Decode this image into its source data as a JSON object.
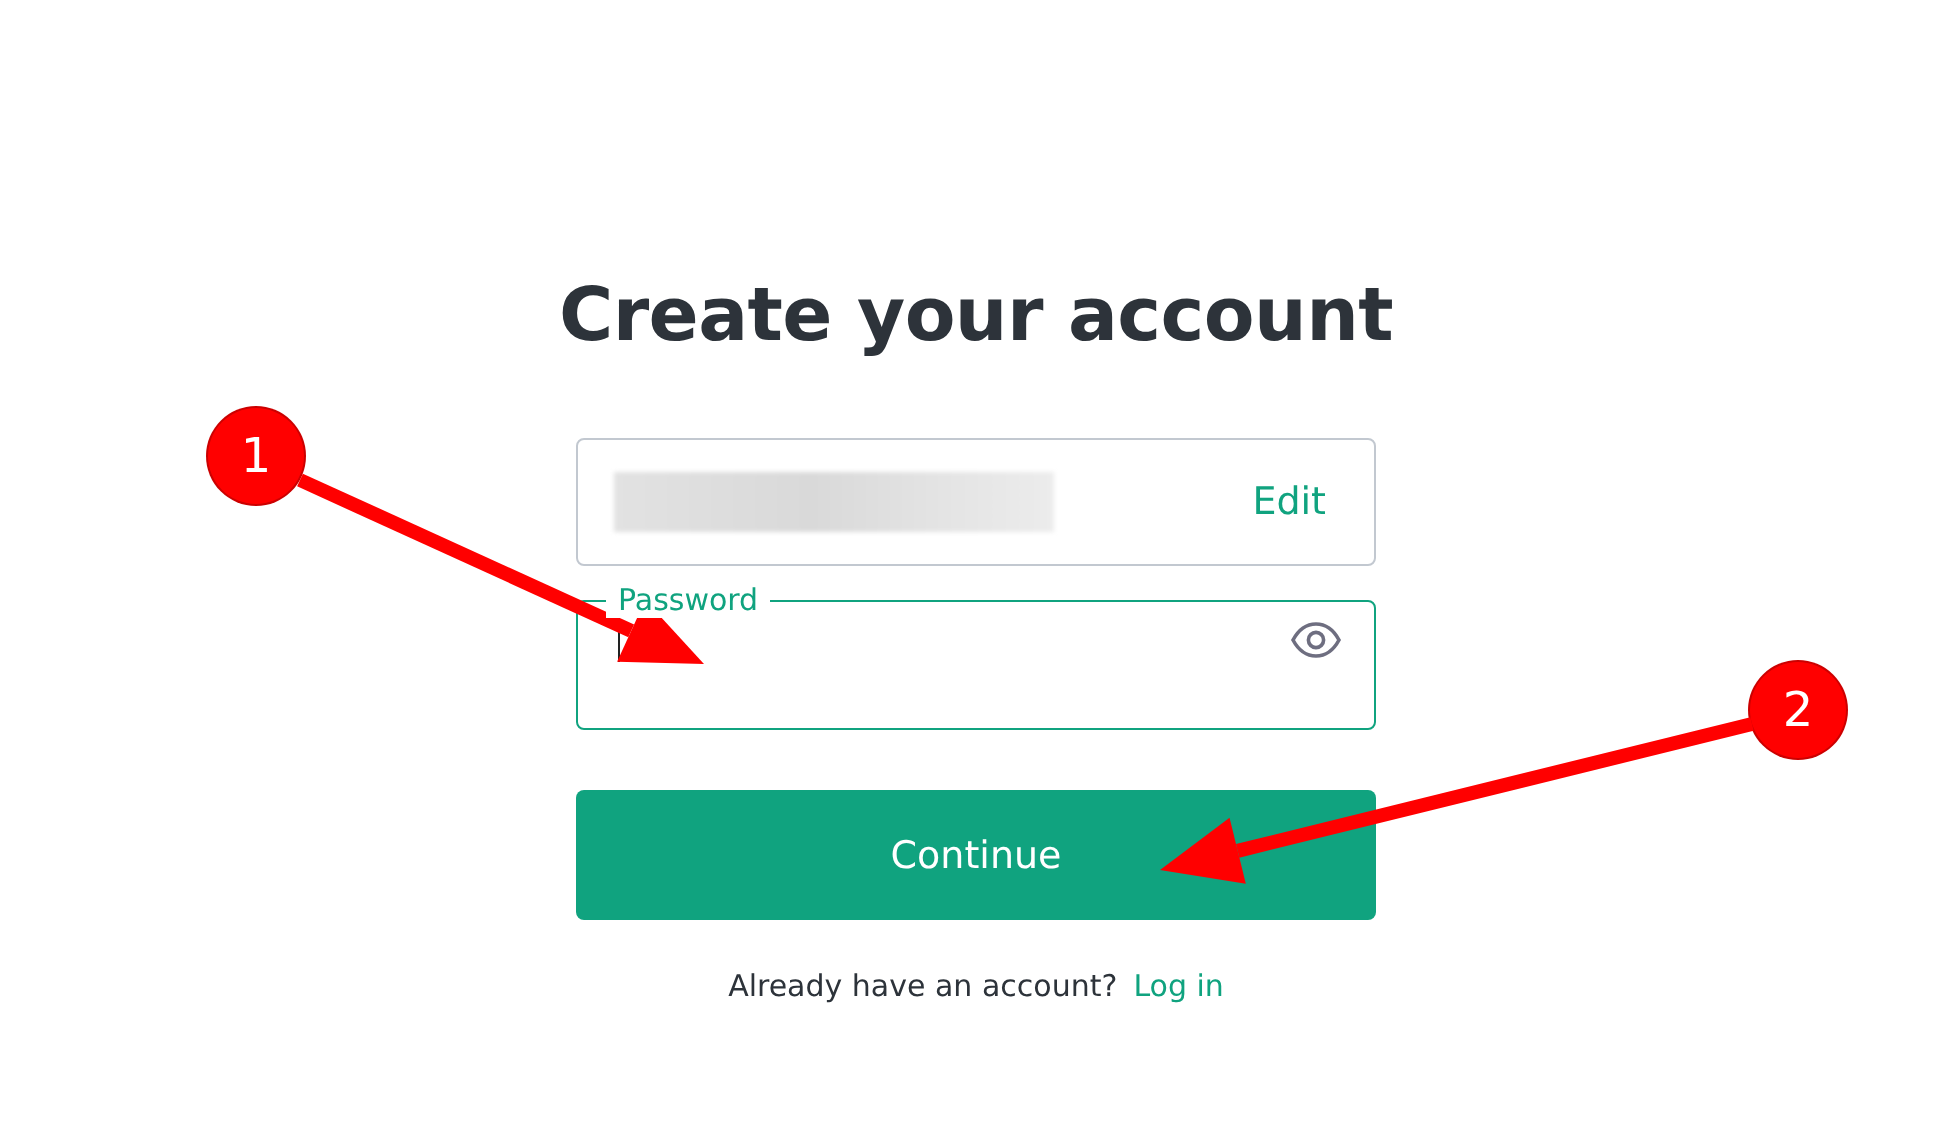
{
  "title": "Create your account",
  "email_field": {
    "redacted": true,
    "action": "Edit"
  },
  "password_field": {
    "label": "Password",
    "focused": true
  },
  "continue_button": "Continue",
  "footer": {
    "text": "Already have an account?",
    "link": "Log in"
  },
  "annotations": [
    {
      "label": "1"
    },
    {
      "label": "2"
    }
  ]
}
